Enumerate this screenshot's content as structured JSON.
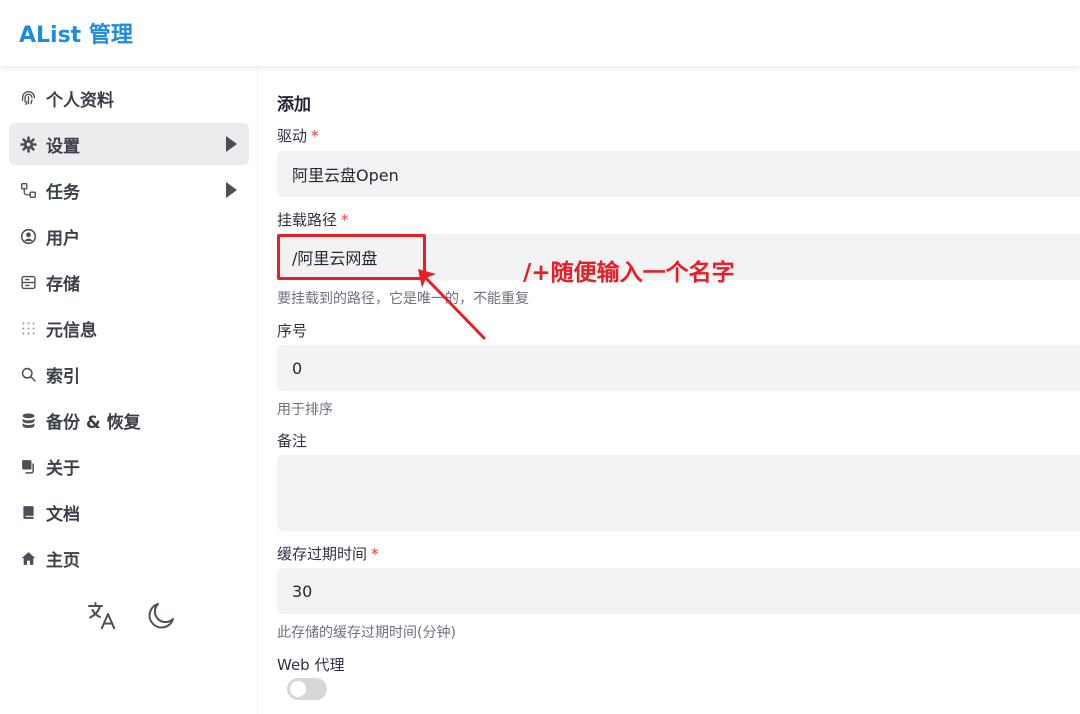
{
  "header": {
    "brand": "AList 管理"
  },
  "sidebar": {
    "items": [
      {
        "label": "个人资料",
        "icon": "fingerprint-icon",
        "has_arrow": false,
        "active": false
      },
      {
        "label": "设置",
        "icon": "gear-icon",
        "has_arrow": true,
        "active": true
      },
      {
        "label": "任务",
        "icon": "workflow-icon",
        "has_arrow": true,
        "active": false
      },
      {
        "label": "用户",
        "icon": "user-circle-icon",
        "has_arrow": false,
        "active": false
      },
      {
        "label": "存储",
        "icon": "storage-icon",
        "has_arrow": false,
        "active": false
      },
      {
        "label": "元信息",
        "icon": "meta-grid-icon",
        "has_arrow": false,
        "active": false
      },
      {
        "label": "索引",
        "icon": "search-icon",
        "has_arrow": false,
        "active": false
      },
      {
        "label": "备份 & 恢复",
        "icon": "database-icon",
        "has_arrow": false,
        "active": false
      },
      {
        "label": "关于",
        "icon": "copy-icon",
        "has_arrow": false,
        "active": false
      },
      {
        "label": "文档",
        "icon": "book-icon",
        "has_arrow": false,
        "active": false
      },
      {
        "label": "主页",
        "icon": "home-icon",
        "has_arrow": false,
        "active": false
      }
    ],
    "tools": {
      "language_icon": "translate-icon",
      "theme_icon": "moon-icon"
    }
  },
  "form": {
    "title": "添加",
    "driver": {
      "label": "驱动",
      "required_mark": "*",
      "value": "阿里云盘Open"
    },
    "mount_path": {
      "label": "挂载路径",
      "required_mark": "*",
      "value": "/阿里云网盘",
      "helper": "要挂载到的路径，它是唯一的，不能重复"
    },
    "order": {
      "label": "序号",
      "value": "0",
      "helper": "用于排序"
    },
    "remark": {
      "label": "备注",
      "value": ""
    },
    "cache_expiration": {
      "label": "缓存过期时间",
      "required_mark": "*",
      "value": "30",
      "helper": "此存储的缓存过期时间(分钟)"
    },
    "web_proxy": {
      "label": "Web 代理",
      "enabled": false
    }
  },
  "annotation": {
    "text": "/+随便输入一个名字",
    "color": "#e81e25"
  },
  "colors": {
    "brand": "#1d8ce0",
    "required": "#e53e3e",
    "input_bg": "#f1f2f4",
    "active_nav_bg": "#ececee"
  }
}
